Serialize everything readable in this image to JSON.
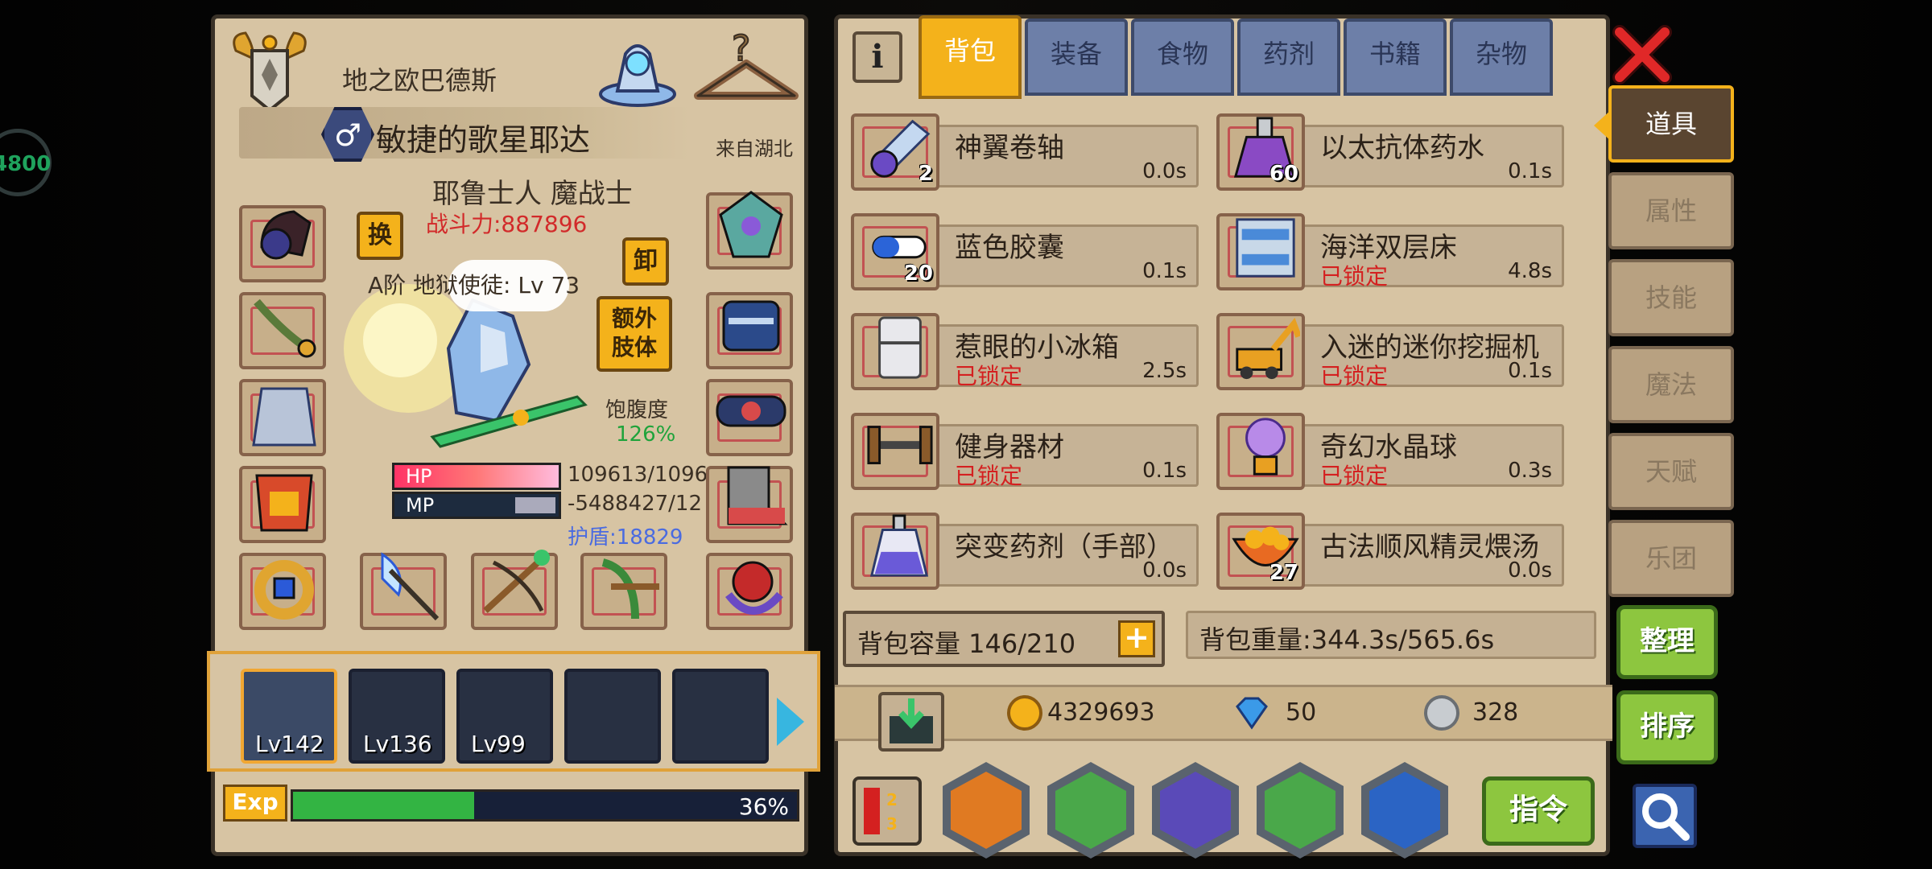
{
  "character": {
    "realm_name": "地之欧巴德斯",
    "title": "敏捷的歌星耶达",
    "gender_symbol": "♂",
    "origin": "来自湖北",
    "race_class": "耶鲁士人 魔战士",
    "power": "战斗力:887896",
    "level_label": "A阶 地狱使徒: Lv 73",
    "swap_label": "换",
    "unequip_label": "卸",
    "extra_limb_label": "额外\n肢体",
    "satiety_label": "饱腹度",
    "satiety_value": "126%",
    "hp_label": "HP",
    "mp_label": "MP",
    "hp_text": "109613/1096",
    "mp_text": "-5488427/12",
    "shield_text": "护盾:18829"
  },
  "team": [
    {
      "lv": "Lv142",
      "active": true
    },
    {
      "lv": "Lv136",
      "active": false
    },
    {
      "lv": "Lv99",
      "active": false
    },
    {
      "lv": "",
      "active": false
    },
    {
      "lv": "",
      "active": false
    }
  ],
  "exp": {
    "tag": "Exp",
    "percent_text": "36%",
    "fraction": 0.36
  },
  "inventory": {
    "info_icon": "i",
    "tabs": [
      "背包",
      "装备",
      "食物",
      "药剂",
      "书籍",
      "杂物"
    ],
    "active_tab": 0,
    "items": [
      {
        "name": "神翼卷轴",
        "qty": "2",
        "weight": "0.0s",
        "locked": "",
        "icon": "scroll-icon"
      },
      {
        "name": "以太抗体药水",
        "qty": "60",
        "weight": "0.1s",
        "locked": "",
        "icon": "potion-icon"
      },
      {
        "name": "蓝色胶囊",
        "qty": "20",
        "weight": "0.1s",
        "locked": "",
        "icon": "capsule-icon"
      },
      {
        "name": "海洋双层床",
        "qty": "",
        "weight": "4.8s",
        "locked": "已锁定",
        "icon": "bunk-bed-icon"
      },
      {
        "name": "惹眼的小冰箱",
        "qty": "",
        "weight": "2.5s",
        "locked": "已锁定",
        "icon": "fridge-icon"
      },
      {
        "name": "入迷的迷你挖掘机",
        "qty": "",
        "weight": "0.1s",
        "locked": "已锁定",
        "icon": "excavator-icon"
      },
      {
        "name": "健身器材",
        "qty": "",
        "weight": "0.1s",
        "locked": "已锁定",
        "icon": "gym-icon"
      },
      {
        "name": "奇幻水晶球",
        "qty": "",
        "weight": "0.3s",
        "locked": "已锁定",
        "icon": "crystal-ball-icon"
      },
      {
        "name": "突变药剂（手部）",
        "qty": "",
        "weight": "0.0s",
        "locked": "",
        "icon": "flask-icon"
      },
      {
        "name": "古法顺风精灵煨汤",
        "qty": "27",
        "weight": "0.0s",
        "locked": "",
        "icon": "soup-icon"
      }
    ],
    "capacity": "背包容量 146/210",
    "weight": "背包重量:344.3s/565.6s",
    "gold": "4329693",
    "diamonds": "50",
    "silver": "328",
    "command_label": "指令"
  },
  "side_tabs": [
    "道具",
    "属性",
    "技能",
    "魔法",
    "天赋",
    "乐团"
  ],
  "side_active": 0,
  "buttons": {
    "organize": "整理",
    "sort": "排序"
  },
  "colors": {
    "accent": "#f4b21b",
    "locked": "#d42020",
    "green": "#8dc63f",
    "panel": "#d7c4a3"
  }
}
